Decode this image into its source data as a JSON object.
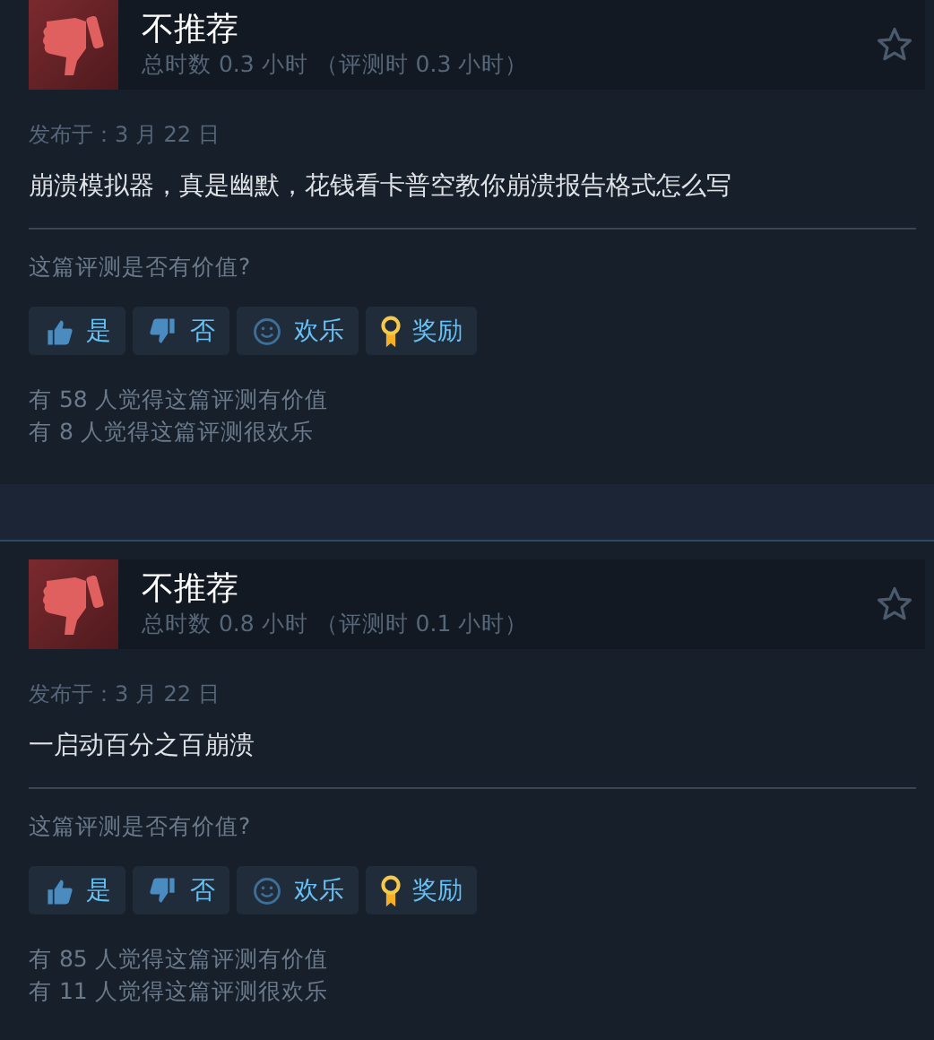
{
  "reviews": [
    {
      "verdict": "不推荐",
      "recommended": false,
      "hours": "总时数 0.3 小时 （评测时 0.3 小时）",
      "posted": "发布于：3 月 22 日",
      "text": "崩溃模拟器，真是幽默，花钱看卡普空教你崩溃报告格式怎么写",
      "helpful_prompt": "这篇评测是否有价值?",
      "buttons": [
        {
          "kind": "yes",
          "label": "是"
        },
        {
          "kind": "no",
          "label": "否"
        },
        {
          "kind": "funny",
          "label": "欢乐"
        },
        {
          "kind": "award",
          "label": "奖励"
        }
      ],
      "stats": [
        "有 58 人觉得这篇评测有价值",
        "有 8 人觉得这篇评测很欢乐"
      ]
    },
    {
      "verdict": "不推荐",
      "recommended": false,
      "hours": "总时数 0.8 小时 （评测时 0.1 小时）",
      "posted": "发布于：3 月 22 日",
      "text": "一启动百分之百崩溃",
      "helpful_prompt": "这篇评测是否有价值?",
      "buttons": [
        {
          "kind": "yes",
          "label": "是"
        },
        {
          "kind": "no",
          "label": "否"
        },
        {
          "kind": "funny",
          "label": "欢乐"
        },
        {
          "kind": "award",
          "label": "奖励"
        }
      ],
      "stats": [
        "有 85 人觉得这篇评测有价值",
        "有 11 人觉得这篇评测很欢乐"
      ]
    }
  ]
}
